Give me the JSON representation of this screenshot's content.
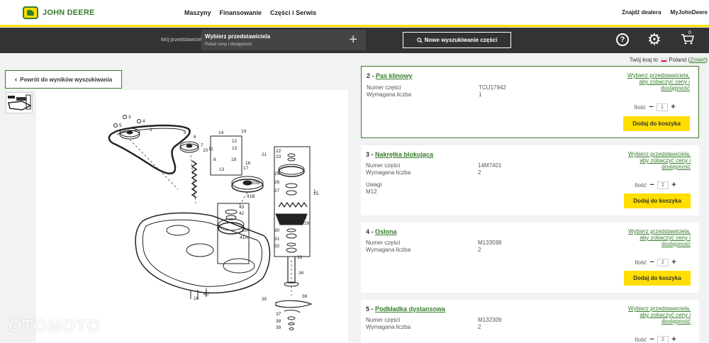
{
  "nav": {
    "brand": "JOHN DEERE",
    "links": [
      "Maszyny",
      "Finansowanie",
      "Części i Serwis"
    ],
    "right": [
      "Znajdź dealera",
      "MyJohnDeere"
    ]
  },
  "dealer": {
    "label": "Mój przedstawiciel",
    "title": "Wybierz przedstawiciela",
    "subtitle": "Pokaż ceny i dostępność",
    "plus": "+"
  },
  "search": {
    "label": "Nowe wyszukiwanie części"
  },
  "cart": {
    "count": "0"
  },
  "country": {
    "prefix": "Twój kraj to",
    "name": "Poland",
    "change": "Zmień"
  },
  "back": {
    "label": "Powrót do wyników wyszukiwania"
  },
  "watermark": "OTOMOTO",
  "parts": [
    {
      "num": "2 - ",
      "name": "Pas klinowy",
      "part_label": "Numer części",
      "part_no": "TCU17942",
      "qty_label": "Wymagana liczba",
      "qty_req": "1",
      "notes_label": "",
      "notes": "",
      "price": "Wybierz przedstawiciela, aby zobaczyć ceny i dostępność",
      "amount_label": "Ilość",
      "amount": "1",
      "add": "Dodaj do koszyka"
    },
    {
      "num": "3 - ",
      "name": "Nakrętka blokująca",
      "part_label": "Numer części",
      "part_no": "14M7401",
      "qty_label": "Wymagana liczba",
      "qty_req": "2",
      "notes_label": "Uwagi",
      "notes": "M12",
      "price": "Wybierz przedstawiciela, aby zobaczyć ceny i dostępność",
      "amount_label": "Ilość",
      "amount": "2",
      "add": "Dodaj do koszyka"
    },
    {
      "num": "4 - ",
      "name": "Osłona",
      "part_label": "Numer części",
      "part_no": "M133598",
      "qty_label": "Wymagana liczba",
      "qty_req": "2",
      "notes_label": "",
      "notes": "",
      "price": "Wybierz przedstawiciela, aby zobaczyć ceny i dostępność",
      "amount_label": "Ilość",
      "amount": "2",
      "add": "Dodaj do koszyka"
    },
    {
      "num": "5 - ",
      "name": "Podkładka dystansowa",
      "part_label": "Numer części",
      "part_no": "M132309",
      "qty_label": "Wymagana liczba",
      "qty_req": "2",
      "notes_label": "",
      "notes": "",
      "price": "Wybierz przedstawiciela, aby zobaczyć ceny i dostępność",
      "amount_label": "Ilość",
      "amount": "2",
      "add": ""
    }
  ],
  "diagram_callouts": [
    "3",
    "2",
    "4",
    "5",
    "12",
    "13",
    "14",
    "19",
    "11",
    "10",
    "17",
    "21",
    "22",
    "23",
    "25",
    "26",
    "28",
    "29",
    "30",
    "31",
    "32",
    "33",
    "34",
    "35",
    "36",
    "37",
    "38",
    "39",
    "40",
    "41B",
    "41A",
    "20A",
    "20B",
    "43",
    "42",
    "18",
    "16",
    "8",
    "7",
    "6",
    "9",
    "15",
    "1"
  ]
}
